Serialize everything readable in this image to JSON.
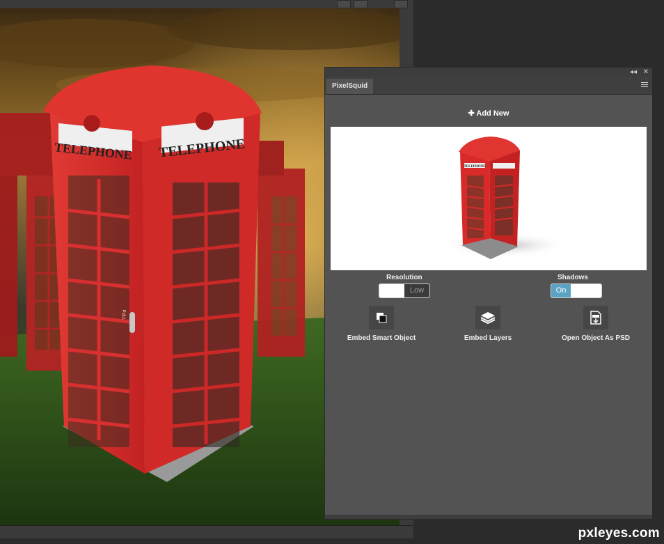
{
  "watermark": "pxleyes.com",
  "panel": {
    "tab_label": "PixelSquid",
    "collapse_glyph": "◂◂",
    "close_glyph": "✕",
    "add_new_label": "✚ Add New",
    "options": {
      "resolution": {
        "label": "Resolution",
        "value": "Low"
      },
      "shadows": {
        "label": "Shadows",
        "value": "On"
      }
    },
    "actions": [
      {
        "label": "Embed Smart Object",
        "icon": "smart-object-icon"
      },
      {
        "label": "Embed Layers",
        "icon": "layers-icon"
      },
      {
        "label": "Open Object As PSD",
        "icon": "psd-file-icon"
      }
    ],
    "preview_sign": "TELEPHONE"
  },
  "canvas": {
    "sign_left": "TELEPHONE",
    "sign_right": "TELEPHONE",
    "door_text": "PULL"
  },
  "colors": {
    "booth_red": "#d42a2a",
    "accent_blue": "#5ba3c4",
    "panel_bg": "#535353"
  }
}
